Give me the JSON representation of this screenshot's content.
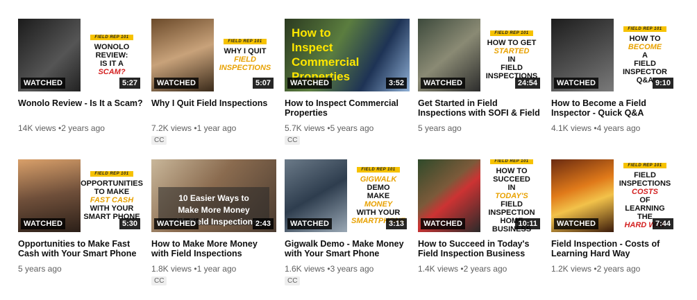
{
  "colors": {
    "accent": "#f6c200",
    "meta": "#606060",
    "title": "#0f0f0f",
    "badge_bg": "#000000"
  },
  "videos": [
    {
      "title": "Wonolo Review - Is It a Scam?",
      "views": "14K views",
      "age": "2 years ago",
      "cc": "",
      "watched": "WATCHED",
      "duration": "5:27",
      "thumb": {
        "ribbon": "FIELD REP 101",
        "lines": [
          "WONOLO",
          "REVIEW:",
          "IS IT A",
          "SCAM?"
        ]
      }
    },
    {
      "title": "Why I Quit Field Inspections",
      "views": "7.2K views",
      "age": "1 year ago",
      "cc": "CC",
      "watched": "WATCHED",
      "duration": "5:07",
      "thumb": {
        "ribbon": "FIELD REP 101",
        "lines": [
          "WHY I Quit",
          "FIELD",
          "INSPECTIONS"
        ]
      }
    },
    {
      "title": "How to Inspect Commercial Properties",
      "views": "5.7K views",
      "age": "5 years ago",
      "cc": "CC",
      "watched": "WATCHED",
      "duration": "3:52",
      "thumb": {
        "lines": [
          "How to",
          "Inspect",
          "Commercial",
          "Properties"
        ]
      }
    },
    {
      "title": "Get Started in Field Inspections with SOFI & Field",
      "views": "",
      "age": "5 years ago",
      "cc": "",
      "watched": "WATCHED",
      "duration": "24:54",
      "thumb": {
        "ribbon": "FIELD REP 101",
        "lines": [
          "HOW TO GET",
          "STARTED",
          "IN",
          "FIELD",
          "INSPECTIONS"
        ]
      }
    },
    {
      "title": "How to Become a Field Inspector - Quick Q&A",
      "views": "4.1K views",
      "age": "4 years ago",
      "cc": "",
      "watched": "WATCHED",
      "duration": "9:10",
      "thumb": {
        "ribbon": "FIELD REP 101",
        "lines": [
          "HOW TO",
          "BECOME",
          "A",
          "FIELD",
          "INSPECTOR",
          "Q&A"
        ]
      }
    },
    {
      "title": "Opportunities to Make Fast Cash with Your Smart Phone",
      "views": "",
      "age": "5 years ago",
      "cc": "",
      "watched": "WATCHED",
      "duration": "5:30",
      "thumb": {
        "ribbon": "FIELD REP 101",
        "lines": [
          "OPPORTUNITIES",
          "TO MAKE",
          "FAST CASH",
          "WITH YOUR",
          "SMART PHONE"
        ]
      }
    },
    {
      "title": "How to Make More Money with Field Inspections",
      "views": "1.8K views",
      "age": "1 year ago",
      "cc": "CC",
      "watched": "WATCHED",
      "duration": "2:43",
      "thumb": {
        "lines": [
          "10 Easier Ways to",
          "Make More Money",
          "with Field Inspections"
        ]
      }
    },
    {
      "title": "Gigwalk Demo - Make Money with Your Smart Phone",
      "views": "1.6K views",
      "age": "3 years ago",
      "cc": "CC",
      "watched": "WATCHED",
      "duration": "3:13",
      "thumb": {
        "ribbon": "FIELD REP 101",
        "lines": [
          "Gigwalk",
          "demo",
          "MAKE",
          "MONEY",
          "with your",
          "SMARTPHONE"
        ]
      }
    },
    {
      "title": "How to Succeed in Today's Field Inspection Business",
      "views": "1.4K views",
      "age": "2 years ago",
      "cc": "",
      "watched": "WATCHED",
      "duration": "10:11",
      "thumb": {
        "ribbon": "FIELD REP 101",
        "lines": [
          "HOW TO",
          "SUCCEED",
          "IN",
          "TODAY'S",
          "FIELD INSPECTION",
          "HOME",
          "BUSINESS"
        ]
      }
    },
    {
      "title": "Field Inspection - Costs of Learning Hard Way",
      "views": "1.2K views",
      "age": "2 years ago",
      "cc": "",
      "watched": "WATCHED",
      "duration": "7:44",
      "thumb": {
        "ribbon": "FIELD REP 101",
        "lines": [
          "FIELD",
          "INSPECTIONS",
          "COSTS",
          "OF",
          "LEARNING THE",
          "HARD WAY"
        ]
      }
    }
  ]
}
